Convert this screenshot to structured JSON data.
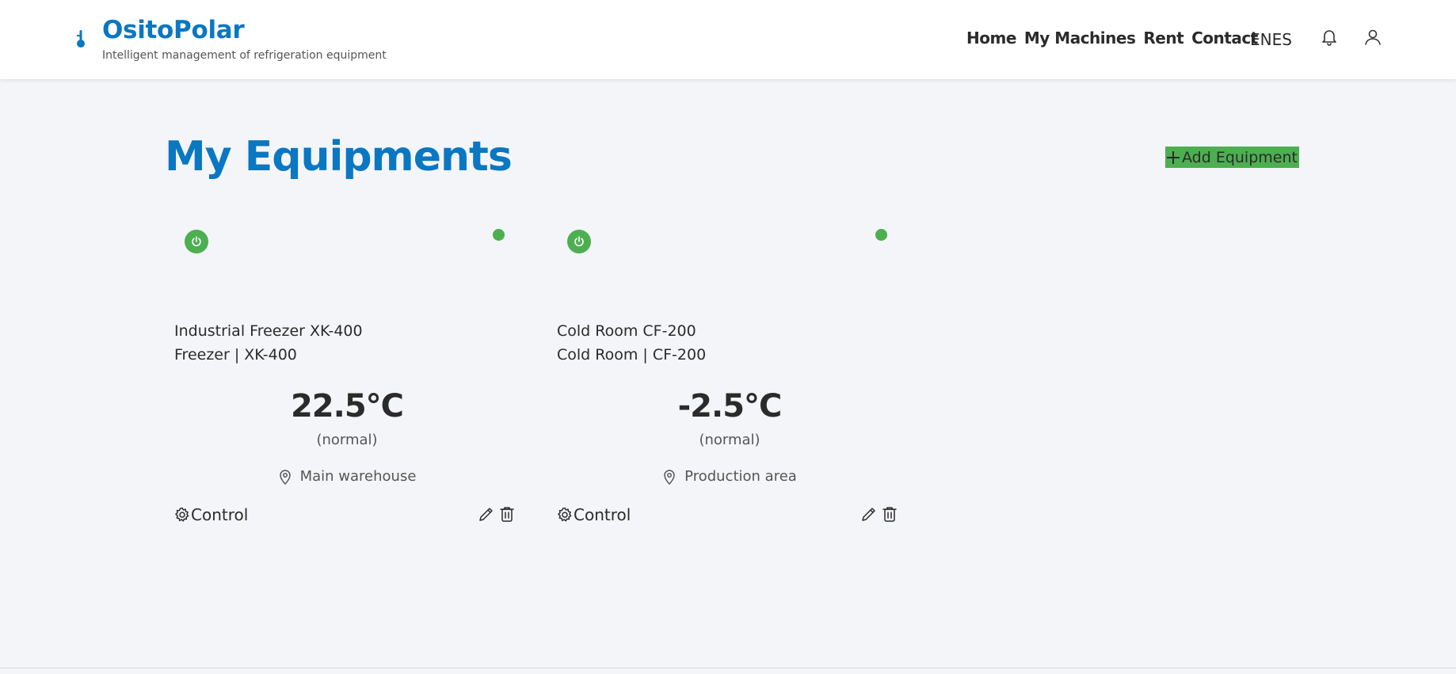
{
  "header": {
    "brand_name": "OsitoPolar",
    "tagline": "Intelligent management of refrigeration equipment",
    "nav": [
      "Home",
      "My Machines",
      "Rent",
      "Contact"
    ],
    "languages": "ENES"
  },
  "main": {
    "title": "My Equipments",
    "add_button": "Add Equipment"
  },
  "cards": [
    {
      "name": "Industrial Freezer XK-400",
      "type_model": "Freezer | XK-400",
      "temperature": "22.5°C",
      "state": "(normal)",
      "location": "Main warehouse",
      "control_label": "Control"
    },
    {
      "name": "Cold Room CF-200",
      "type_model": "Cold Room | CF-200",
      "temperature": "-2.5°C",
      "state": "(normal)",
      "location": "Production area",
      "control_label": "Control"
    }
  ],
  "colors": {
    "brand": "#0a77c2",
    "status_green": "#4caf50",
    "background": "#f4f5f8"
  },
  "icons": [
    "thermometer-icon",
    "bell-icon",
    "user-icon",
    "plus-icon",
    "power-icon",
    "location-pin-icon",
    "gear-icon",
    "pencil-icon",
    "trash-icon"
  ]
}
